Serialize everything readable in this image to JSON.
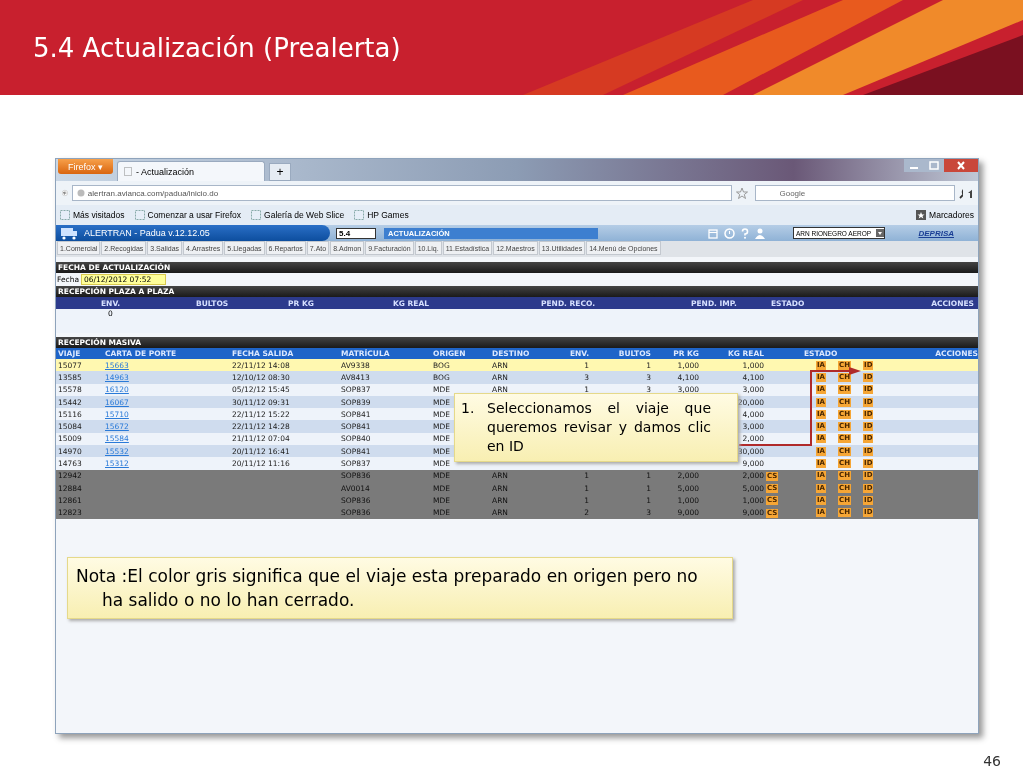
{
  "slide": {
    "title": "5.4 Actualización (Prealerta)",
    "page_number": "46"
  },
  "browser": {
    "menu_button": "Firefox ▾",
    "tab": "- Actualización",
    "new_tab": "+",
    "url": "alertran.avianca.com/padua/inicio.do",
    "search_placeholder": "Google",
    "bookmarks": [
      "Más visitados",
      "Comenzar a usar Firefox",
      "Galería de Web Slice",
      "HP Games"
    ],
    "bookmarks_menu": "Marcadores"
  },
  "app": {
    "title": "ALERTRAN - Padua  v.12.12.05",
    "code_field": "5.4",
    "screen_title": "ACTUALIZACIÓN",
    "branch": "ARN RIONEGRO AEROP",
    "logo": "DEPRISA",
    "menu": [
      {
        "label": "1.Comercial",
        "selected": false
      },
      {
        "label": "2.Recogidas",
        "selected": false
      },
      {
        "label": "3.Salidas",
        "selected": false
      },
      {
        "label": "4.Arrastres",
        "selected": false
      },
      {
        "label": "5.Llegadas",
        "selected": false
      },
      {
        "label": "6.Repartos",
        "selected": false
      },
      {
        "label": "7.Ato",
        "selected": false
      },
      {
        "label": "8.Admon",
        "selected": false
      },
      {
        "label": "9.Facturación",
        "selected": false
      },
      {
        "label": "10.Liq.",
        "selected": false
      },
      {
        "label": "11.Estadística",
        "selected": false
      },
      {
        "label": "12.Maestros",
        "selected": false
      },
      {
        "label": "13.Utilidades",
        "selected": false
      },
      {
        "label": "14.Menú de Opciones",
        "selected": false
      }
    ]
  },
  "fecha_section": {
    "heading": "FECHA DE ACTUALIZACIÓN",
    "label": "Fecha",
    "value": "06/12/2012 07:52"
  },
  "plaza_section": {
    "heading": "RECEPCIÓN PLAZA A PLAZA",
    "columns": [
      "ENV.",
      "BULTOS",
      "PR KG",
      "KG REAL",
      "PEND. RECO.",
      "PEND. IMP.",
      "ESTADO",
      "ACCIONES"
    ],
    "values": [
      "0"
    ]
  },
  "masiva_section": {
    "heading": "RECEPCIÓN MASIVA",
    "columns": [
      "VIAJE",
      "CARTA DE PORTE",
      "FECHA SALIDA",
      "MATRÍCULA",
      "ORIGEN",
      "DESTINO",
      "ENV.",
      "BULTOS",
      "PR KG",
      "KG REAL",
      "ESTADO",
      "ACCIONES"
    ],
    "rows": [
      {
        "selected": true,
        "prepared": false,
        "cells": [
          "15077",
          "15663",
          "22/11/12 14:08",
          "AV9338",
          "BOG",
          "ARN",
          "1",
          "1",
          "1,000",
          "1,000"
        ],
        "badges": [
          "IA",
          "CH",
          "ID"
        ]
      },
      {
        "selected": false,
        "prepared": false,
        "cells": [
          "13585",
          "14963",
          "12/10/12 08:30",
          "AV8413",
          "BOG",
          "ARN",
          "3",
          "3",
          "4,100",
          "4,100"
        ],
        "badges": [
          "IA",
          "CH",
          "ID"
        ]
      },
      {
        "selected": false,
        "prepared": false,
        "cells": [
          "15578",
          "16120",
          "05/12/12 15:45",
          "SOP837",
          "MDE",
          "ARN",
          "1",
          "3",
          "3,000",
          "3,000"
        ],
        "badges": [
          "IA",
          "CH",
          "ID"
        ]
      },
      {
        "selected": false,
        "prepared": false,
        "cells": [
          "15442",
          "16067",
          "30/11/12 09:31",
          "SOP839",
          "MDE",
          null,
          null,
          null,
          null,
          "20,000"
        ],
        "badges": [
          "IA",
          "CH",
          "ID"
        ]
      },
      {
        "selected": false,
        "prepared": false,
        "cells": [
          "15116",
          "15710",
          "22/11/12 15:22",
          "SOP841",
          "MDE",
          null,
          null,
          null,
          null,
          "4,000"
        ],
        "badges": [
          "IA",
          "CH",
          "ID"
        ]
      },
      {
        "selected": false,
        "prepared": false,
        "cells": [
          "15084",
          "15672",
          "22/11/12 14:28",
          "SOP841",
          "MDE",
          null,
          null,
          null,
          null,
          "3,000"
        ],
        "badges": [
          "IA",
          "CH",
          "ID"
        ]
      },
      {
        "selected": false,
        "prepared": false,
        "cells": [
          "15009",
          "15584",
          "21/11/12 07:04",
          "SOP840",
          "MDE",
          null,
          null,
          null,
          null,
          "2,000"
        ],
        "badges": [
          "IA",
          "CH",
          "ID"
        ]
      },
      {
        "selected": false,
        "prepared": false,
        "cells": [
          "14970",
          "15532",
          "20/11/12 16:41",
          "SOP841",
          "MDE",
          null,
          null,
          null,
          null,
          "30,000"
        ],
        "badges": [
          "IA",
          "CH",
          "ID"
        ]
      },
      {
        "selected": false,
        "prepared": false,
        "cells": [
          "14763",
          "15312",
          "20/11/12 11:16",
          "SOP837",
          "MDE",
          null,
          null,
          null,
          null,
          "9,000"
        ],
        "badges": [
          "IA",
          "CH",
          "ID"
        ]
      },
      {
        "selected": false,
        "prepared": true,
        "cells": [
          "12942",
          null,
          null,
          "SOP836",
          "MDE",
          "ARN",
          "1",
          "1",
          "2,000",
          "2,000"
        ],
        "cs": "CS",
        "badges": [
          "IA",
          "CH",
          "ID"
        ]
      },
      {
        "selected": false,
        "prepared": true,
        "cells": [
          "12884",
          null,
          null,
          "AV0014",
          "MDE",
          "ARN",
          "1",
          "1",
          "5,000",
          "5,000"
        ],
        "cs": "CS",
        "badges": [
          "IA",
          "CH",
          "ID"
        ]
      },
      {
        "selected": false,
        "prepared": true,
        "cells": [
          "12861",
          null,
          null,
          "SOP836",
          "MDE",
          "ARN",
          "1",
          "1",
          "1,000",
          "1,000"
        ],
        "cs": "CS",
        "badges": [
          "IA",
          "CH",
          "ID"
        ]
      },
      {
        "selected": false,
        "prepared": true,
        "cells": [
          "12823",
          null,
          null,
          "SOP836",
          "MDE",
          "ARN",
          "2",
          "3",
          "9,000",
          "9,000"
        ],
        "cs": "CS",
        "badges": [
          "IA",
          "CH",
          "ID"
        ]
      }
    ]
  },
  "step_callout": {
    "number": "1.",
    "text": "Seleccionamos el viaje que queremos revisar y damos clic en ID"
  },
  "note_callout": {
    "text": "Nota :El color gris significa que el viaje esta preparado en origen pero no ha salido o no lo han cerrado."
  }
}
